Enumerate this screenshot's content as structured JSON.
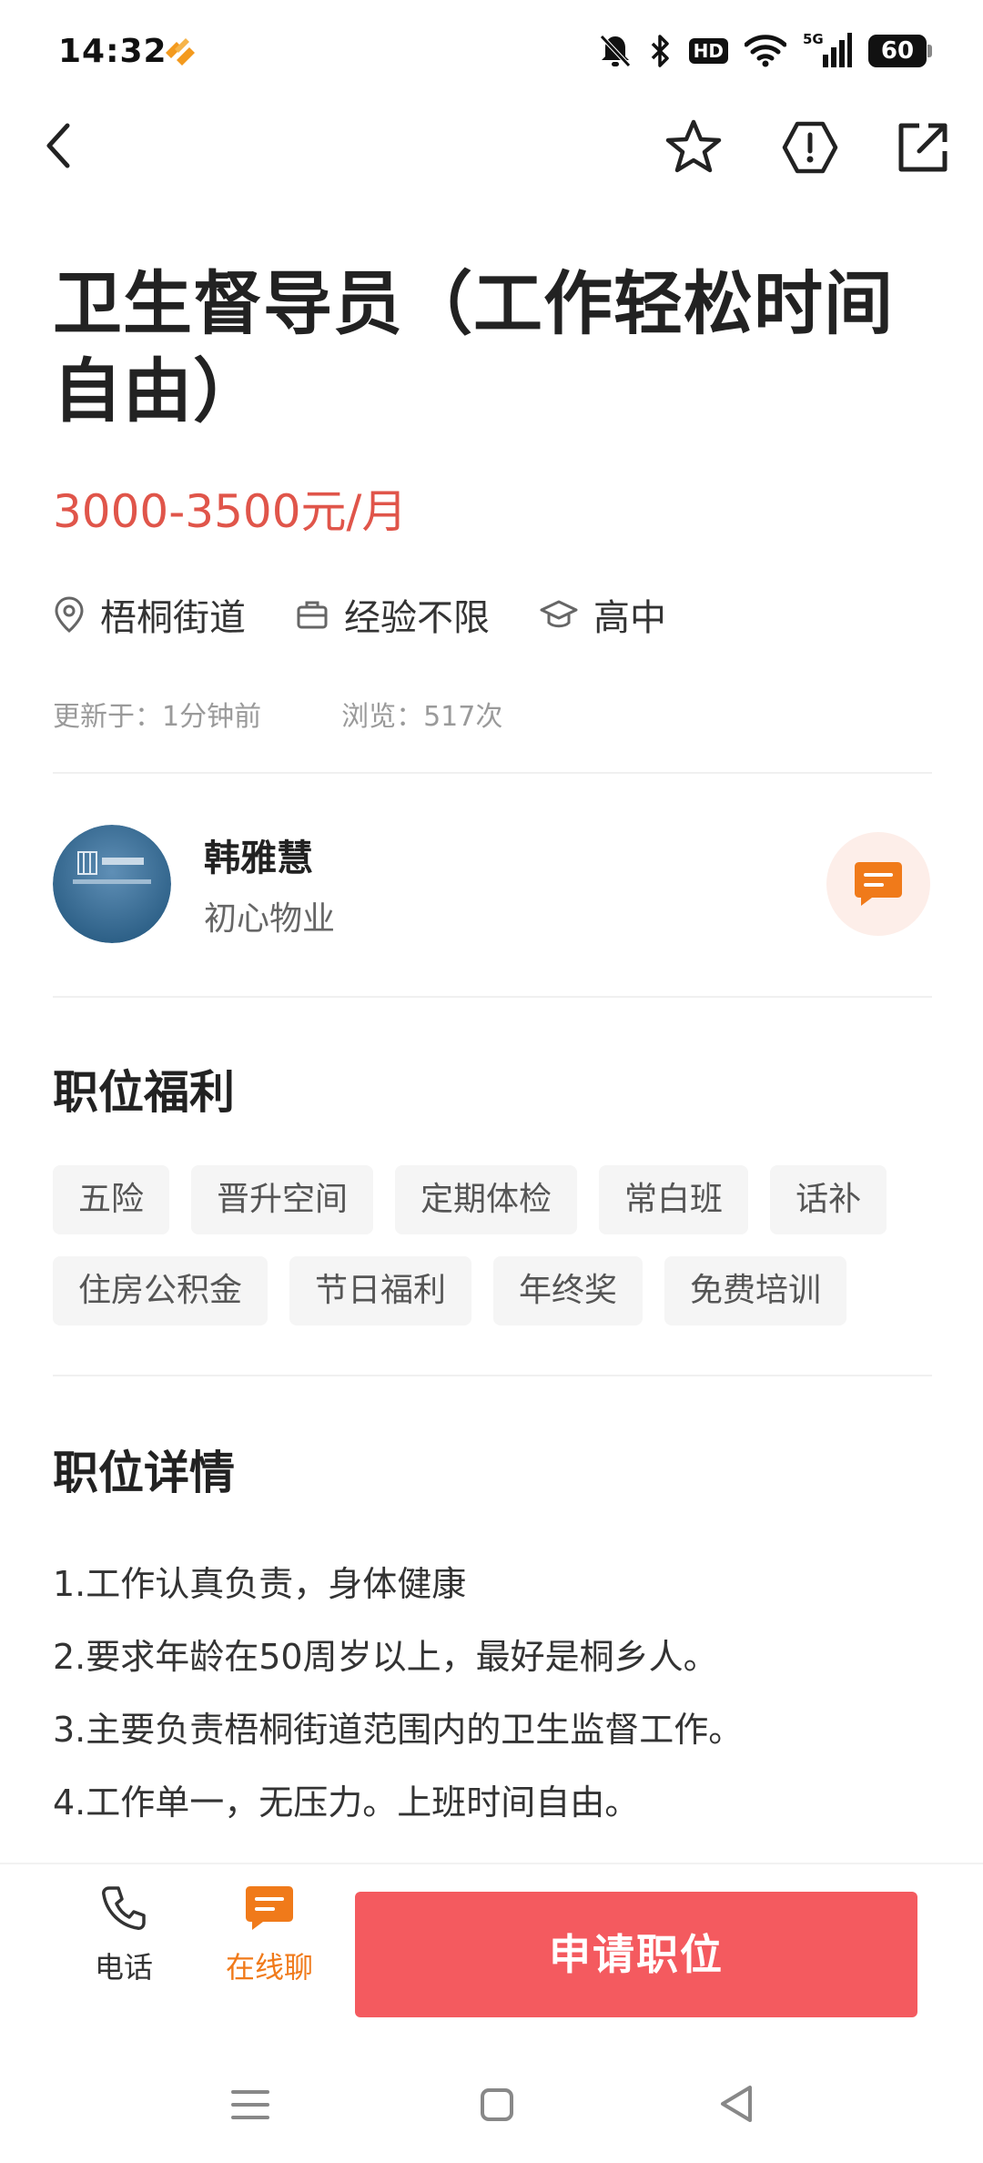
{
  "status_bar": {
    "time": "14:32",
    "network": "5G",
    "hd": "HD",
    "battery": "60",
    "icons": [
      "app-notification-icon",
      "mute-bell-icon",
      "bluetooth-icon",
      "hd-icon",
      "wifi-icon",
      "signal-icon",
      "battery-icon"
    ]
  },
  "nav": {
    "icons": [
      "back-icon",
      "star-icon",
      "report-icon",
      "share-icon"
    ]
  },
  "job": {
    "title": "卫生督导员（工作轻松时间自由）",
    "salary": "3000-3500元/月",
    "location": "梧桐街道",
    "experience": "经验不限",
    "education": "高中",
    "updated": "更新于：1分钟前",
    "views": "浏览：517次"
  },
  "poster": {
    "name": "韩雅慧",
    "company": "初心物业"
  },
  "benefits": {
    "title": "职位福利",
    "tags": [
      "五险",
      "晋升空间",
      "定期体检",
      "常白班",
      "话补",
      "住房公积金",
      "节日福利",
      "年终奖",
      "免费培训"
    ]
  },
  "details": {
    "title": "职位详情",
    "lines": [
      "1.工作认真负责，身体健康",
      "2.要求年龄在50周岁以上，最好是桐乡人。",
      "3.主要负责梧桐街道范围内的卫生监督工作。",
      "4.工作单一，无压力。上班时间自由。"
    ]
  },
  "bottom_bar": {
    "phone_label": "电话",
    "chat_label": "在线聊",
    "apply_label": "申请职位"
  },
  "colors": {
    "salary": "#e0554a",
    "accent_orange": "#f07a1a",
    "apply_button": "#f45a5f"
  }
}
